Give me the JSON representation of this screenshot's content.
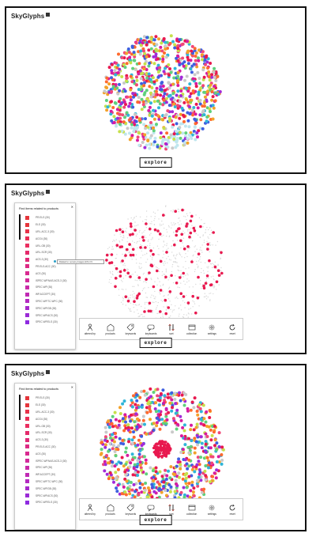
{
  "app": {
    "title": "SkyGlyphs",
    "explore_label": "explore"
  },
  "colors": {
    "dots": [
      "#e8194f",
      "#d81ba0",
      "#a22bd8",
      "#3f5fe0",
      "#2fb5d8",
      "#5fd07c",
      "#c6e04a",
      "#f2a22a",
      "#ff6a2e",
      "#c9c9c9",
      "#f04878"
    ],
    "pink": "#e8194f",
    "faint": "#d9d9d9"
  },
  "filter_panel": {
    "header": "Find items related to products",
    "close_icon": "close-icon",
    "items": [
      {
        "label": "PR.ELS  (30)",
        "color": "#e5353b"
      },
      {
        "label": "ELS  (30)",
        "color": "#e5353b"
      },
      {
        "label": "URL-ACC-3  (30)",
        "color": "#e8344a"
      },
      {
        "label": "ACG4  (30)",
        "color": "#ea2f55"
      },
      {
        "label": "URL-GB  (30)",
        "color": "#ea2f60"
      },
      {
        "label": "URL-SCR  (30)",
        "color": "#e42a6b"
      },
      {
        "label": "ACS-3  (30)",
        "color": "#e02a78"
      },
      {
        "label": "PR.ELS.ACC  (30)",
        "color": "#dd2a84"
      },
      {
        "label": "ACS  (30)",
        "color": "#d82a90"
      },
      {
        "label": "ISPEC.WP.NAS.ACS-3  (30)",
        "color": "#d22a9b"
      },
      {
        "label": "SPEC.WP  (30)",
        "color": "#c92aa8"
      },
      {
        "label": "WP.ACCEPT  (30)",
        "color": "#c02ab4"
      },
      {
        "label": "SPEC.WP.TC-WFC  (30)",
        "color": "#b32ac0"
      },
      {
        "label": "SPEC.WP.GB  (30)",
        "color": "#a62acb"
      },
      {
        "label": "SPEC.WP.ACS  (30)",
        "color": "#9a2ad6"
      },
      {
        "label": "SPEC.WP.ELS  (30)",
        "color": "#8e2ae0"
      }
    ]
  },
  "tooltip": {
    "text": "Related to: sensory.images.ACS-3.9"
  },
  "toolbar": {
    "tools": [
      {
        "label": "altered by",
        "icon": "person-icon"
      },
      {
        "label": "products",
        "icon": "box-icon"
      },
      {
        "label": "keywords",
        "icon": "tag-icon"
      },
      {
        "label": "keyboards",
        "icon": "chat-icon"
      },
      {
        "label": "sort",
        "icon": "sort-icon"
      },
      {
        "label": "collection",
        "icon": "window-icon"
      },
      {
        "label": "settings",
        "icon": "gear-icon"
      },
      {
        "label": "reset",
        "icon": "reset-icon"
      }
    ]
  }
}
